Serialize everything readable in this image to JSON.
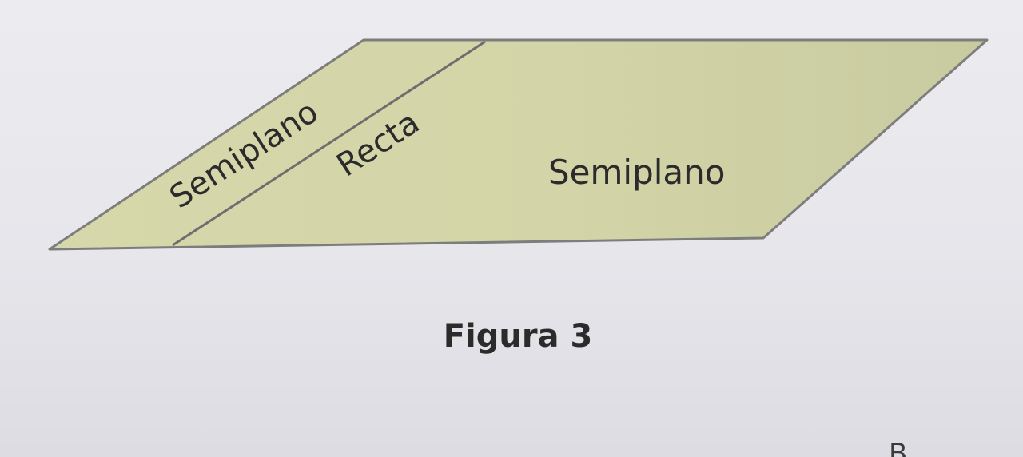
{
  "diagram": {
    "labels": {
      "left_half_plane": "Semiplano",
      "line": "Recta",
      "right_half_plane": "Semiplano"
    },
    "caption": "Figura 3",
    "corner_text": "B"
  },
  "colors": {
    "plane_fill": "#d4d6a9",
    "plane_border": "#7d7d7d",
    "line_color": "#6e6e6e",
    "text_color": "#2b2b2b",
    "background": "#e9e9ed"
  }
}
